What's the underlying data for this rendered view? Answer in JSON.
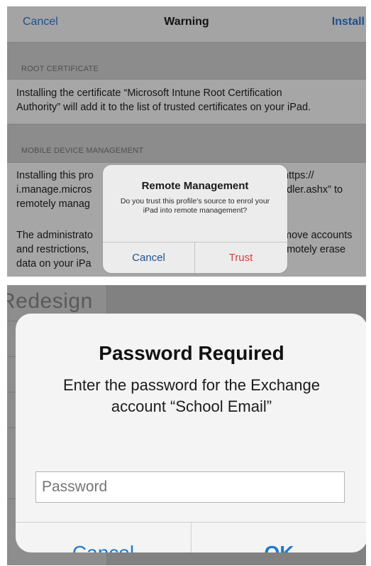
{
  "install_profile": {
    "navbar": {
      "cancel_label": "Cancel",
      "title": "Warning",
      "install_label": "Install"
    },
    "sections": [
      {
        "header": "ROOT CERTIFICATE",
        "lines": [
          "Installing the certificate “Microsoft Intune Root Certification",
          "Authority” will add it to the list of trusted certificates on your iPad."
        ]
      },
      {
        "header": "MOBILE DEVICE MANAGEMENT",
        "lines": [
          "Installing this pro",
          "i.manage.micros",
          "remotely manag",
          "The administrato",
          "and restrictions,",
          "data on your iPa"
        ],
        "right_fragments": [
          "https://",
          "ndler.ashx” to",
          "move accounts",
          "emotely erase"
        ]
      }
    ],
    "alert": {
      "title": "Remote Management",
      "message": "Do you trust this profile's source to enrol your iPad into remote management?",
      "cancel_label": "Cancel",
      "trust_label": "Trust"
    },
    "colors": {
      "accent_blue": "#1f4f8f",
      "destructive_red": "#c8453f"
    }
  },
  "password_prompt": {
    "background_text": "Redesign",
    "alert": {
      "title": "Password Required",
      "message_line1": "Enter the password for the Exchange",
      "message_line2": "account “School Email”",
      "input_value": "",
      "input_placeholder": "Password",
      "cancel_label": "Cancel",
      "ok_label": "OK"
    },
    "colors": {
      "accent_blue": "#1a7bd1"
    }
  }
}
